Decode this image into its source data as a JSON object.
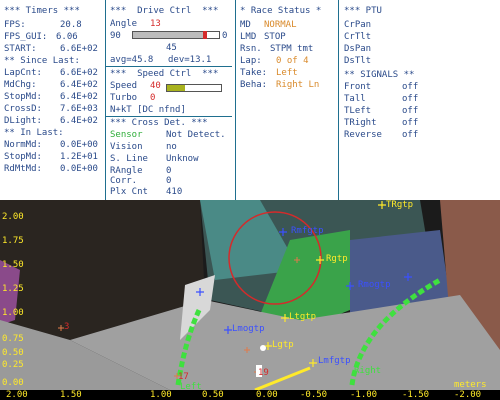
{
  "timers": {
    "title": "*** Timers ***",
    "fps_label": "FPS:",
    "fps": "20.8",
    "fps_gui_label": "FPS_GUI:",
    "fps_gui": "6.06",
    "start_label": "START:",
    "start": "6.6E+02",
    "since_last": "** Since Last:",
    "lapcnt_label": "LapCnt:",
    "lapcnt": "6.6E+02",
    "mdchg_label": "MdChg:",
    "mdchg": "6.4E+02",
    "stopmd_label": "StopMd:",
    "stopmd": "6.4E+02",
    "crossd_label": "CrossD:",
    "crossd": "7.6E+03",
    "dlight_label": "DLight:",
    "dlight": "6.4E+02",
    "in_last": "** In Last:",
    "normmd_label": "NormMd:",
    "normmd": "0.0E+00",
    "stopmd2_label": "StopMd:",
    "stopmd2": "1.2E+01",
    "rdmtmd_label": "RdMtMd:",
    "rdmtmd": "0.0E+00"
  },
  "drive": {
    "title": "***  Drive Ctrl  ***",
    "angle_label": "Angle",
    "angle": "13",
    "slider_min": "90",
    "slider_max": "0",
    "slider_center": "45",
    "slider_value_fraction": 0.84,
    "avg": "avg=45.8",
    "dev": "dev=13.1",
    "speed_title": "***  Speed Ctrl  ***",
    "speed_label": "Speed",
    "speed": "40",
    "speed_fraction": 0.33,
    "turbo_label": "Turbo",
    "turbo": "0",
    "nkt": "N+kT [DC nfnd]",
    "cross_title": "*** Cross Det. ***",
    "sensor_label": "Sensor",
    "sensor": "Not Detect.",
    "vision_label": "Vision",
    "vision": "no",
    "sline_label": "S. Line",
    "sline": "Unknow",
    "rangle_label": "RAngle",
    "rangle": "0",
    "corr_label": "Corr.",
    "corr": "0",
    "plxcnt_label": "Plx Cnt",
    "plxcnt": "410"
  },
  "race": {
    "title": "* Race Status *",
    "md_label": "MD",
    "md": "NORMAL",
    "lmd_label": "LMD",
    "lmd": "STOP",
    "rsn_label": "Rsn.",
    "rsn": "STPM tmt",
    "lap_label": "Lap:",
    "lap": "0 of 4",
    "take_label": "Take:",
    "take": "Left",
    "beha_label": "Beha:",
    "beha": "Right Ln"
  },
  "ptu": {
    "title": "*** PTU",
    "items": [
      "CrPan",
      "CrTlt",
      "DsPan",
      "DsTlt"
    ],
    "signals_title": "** SIGNALS **",
    "signals": [
      {
        "label": "Front",
        "value": "off"
      },
      {
        "label": "Tall",
        "value": "off"
      },
      {
        "label": "TLeft",
        "value": "off"
      },
      {
        "label": "TRight",
        "value": "off"
      },
      {
        "label": "Reverse",
        "value": "off"
      }
    ]
  },
  "camera": {
    "y_ticks": [
      "2.00",
      "1.75",
      "1.50",
      "1.25",
      "1.00",
      "0.75",
      "0.50",
      "0.25",
      "0.00"
    ],
    "x_ticks": [
      "2.00",
      "1.50",
      "1.00",
      "0.50",
      "0.00",
      "-0.50",
      "-1.00",
      "-1.50",
      "-2.00"
    ],
    "x_unit": "meters",
    "markers": {
      "rtgtp": "TRgtp",
      "rmfgtp": "Rmfgtp",
      "rgtp": "Rgtp",
      "rmogtp": "Rmogtp",
      "ltgtp": "Ltgtp",
      "lmogtp": "Lmogtp",
      "lgtp": "Lgtp",
      "lmfgtp": "Lmfgtp",
      "left": "Left",
      "right": "Right",
      "n3": "3",
      "n17": "17",
      "n19": "19"
    }
  },
  "colors": {
    "panel_text": "#2a4a8a",
    "alert_red": "#d42b2b",
    "alert_orange": "#d98a2b",
    "ok_green": "#2fae3a",
    "overlay_yellow": "#ffea2a",
    "lane_green": "#3fe03f"
  }
}
